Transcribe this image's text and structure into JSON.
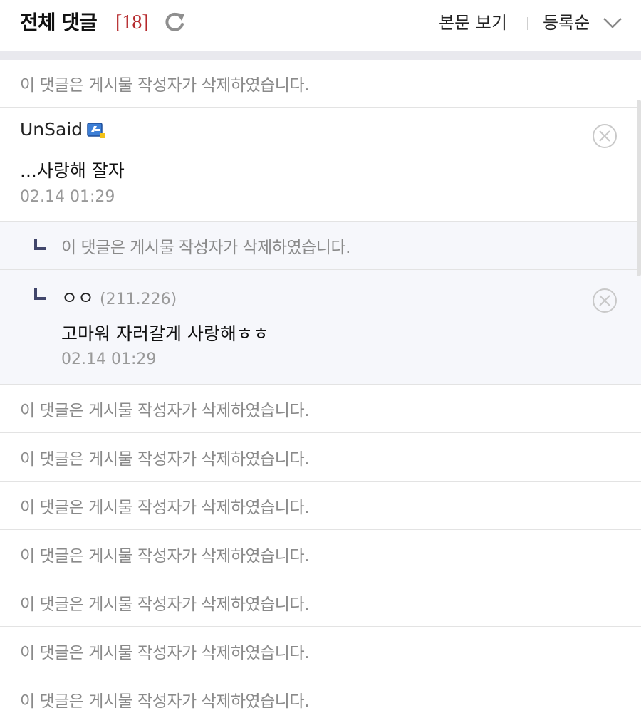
{
  "header": {
    "title": "전체 댓글",
    "count": "[18]",
    "view_body": "본문 보기",
    "sort": "등록순"
  },
  "deleted_message": "이 댓글은 게시물 작성자가 삭제하였습니다.",
  "comment": {
    "nick": "UnSaid",
    "text": "...사랑해 잘자",
    "time": "02.14 01:29"
  },
  "reply_deleted": {
    "text": "이 댓글은 게시물 작성자가 삭제하였습니다."
  },
  "reply": {
    "nick": "ㅇㅇ",
    "ip": "(211.226)",
    "text": "고마워 자러갈게 사랑해ㅎㅎ",
    "time": "02.14 01:29"
  },
  "deleted_rows": [
    "이 댓글은 게시물 작성자가 삭제하였습니다.",
    "이 댓글은 게시물 작성자가 삭제하였습니다.",
    "이 댓글은 게시물 작성자가 삭제하였습니다.",
    "이 댓글은 게시물 작성자가 삭제하였습니다.",
    "이 댓글은 게시물 작성자가 삭제하였습니다.",
    "이 댓글은 게시물 작성자가 삭제하였습니다.",
    "이 댓글은 게시물 작성자가 삭제하였습니다."
  ],
  "colors": {
    "count": "#b5282b",
    "reply_mark": "#41466b",
    "reply_bg": "#f6f7fb"
  }
}
